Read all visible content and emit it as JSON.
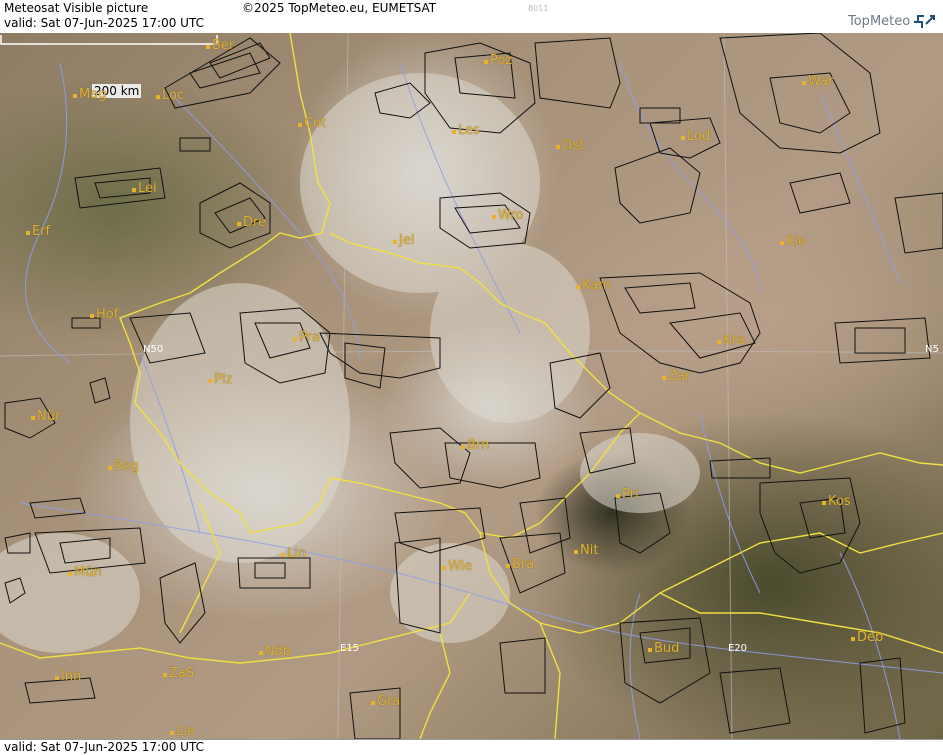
{
  "header": {
    "title": "Meteosat Visible picture",
    "copyright": "©2025 TopMeteo.eu, EUMETSAT",
    "code": "8011",
    "valid": "valid:  Sat  07-Jun-2025  17:00 UTC",
    "logo_text": "TopMeteo"
  },
  "footer": {
    "valid": "valid:  Sat  07-Jun-2025  17:00 UTC"
  },
  "scale": {
    "label": "200 km"
  },
  "grid_labels": [
    {
      "text": "N50"
    },
    {
      "text": "N5"
    },
    {
      "text": "E15"
    },
    {
      "text": "E20"
    }
  ],
  "cities": [
    {
      "name": "Ber"
    },
    {
      "name": "Poz"
    },
    {
      "name": "War"
    },
    {
      "name": "Mag"
    },
    {
      "name": "Loc"
    },
    {
      "name": "Cot"
    },
    {
      "name": "Les"
    },
    {
      "name": "Lod"
    },
    {
      "name": "Ost"
    },
    {
      "name": "Lei"
    },
    {
      "name": "Dre"
    },
    {
      "name": "Wro"
    },
    {
      "name": "Erf"
    },
    {
      "name": "Jel"
    },
    {
      "name": "Kie"
    },
    {
      "name": "Kam"
    },
    {
      "name": "Hof"
    },
    {
      "name": "Pra"
    },
    {
      "name": "Kra"
    },
    {
      "name": "Plz"
    },
    {
      "name": "Zar"
    },
    {
      "name": "Nür"
    },
    {
      "name": "Brn"
    },
    {
      "name": "Reg"
    },
    {
      "name": "Pri"
    },
    {
      "name": "Kos"
    },
    {
      "name": "Lin"
    },
    {
      "name": "Nit"
    },
    {
      "name": "Wie"
    },
    {
      "name": "Bra"
    },
    {
      "name": "Mün"
    },
    {
      "name": "Nöb"
    },
    {
      "name": "Bud"
    },
    {
      "name": "Deb"
    },
    {
      "name": "Inn"
    },
    {
      "name": "ZaS"
    },
    {
      "name": "Gra"
    },
    {
      "name": "Lie"
    }
  ],
  "colors": {
    "border": "#f0e040",
    "river": "#8f9fe6",
    "airspace": "#111111",
    "city": "#e0b234"
  }
}
